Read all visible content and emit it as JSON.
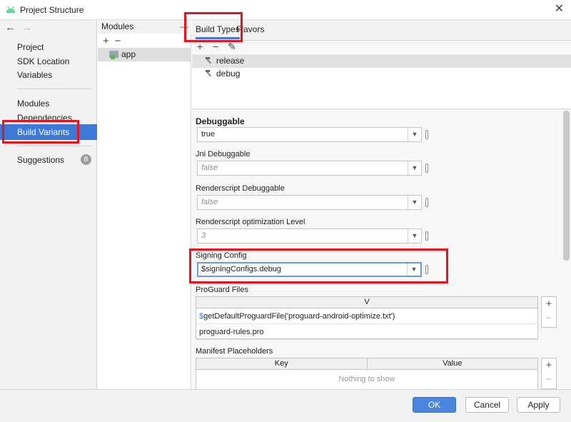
{
  "window": {
    "title": "Project Structure",
    "close_glyph": "✕"
  },
  "nav": {
    "back": "←",
    "forward": "→"
  },
  "sidebar": {
    "items": [
      {
        "label": "Project"
      },
      {
        "label": "SDK Location"
      },
      {
        "label": "Variables"
      },
      {
        "label": "Modules"
      },
      {
        "label": "Dependencies"
      },
      {
        "label": "Build Variants"
      },
      {
        "label": "Suggestions",
        "badge": "8"
      }
    ]
  },
  "modules": {
    "header": "Modules",
    "collapse_glyph": "—",
    "add": "+",
    "remove": "−",
    "items": [
      {
        "label": "app"
      }
    ]
  },
  "tabs": [
    {
      "label": "Build Types"
    },
    {
      "label": "Flavors"
    }
  ],
  "build_types": {
    "add": "+",
    "remove": "−",
    "edit": "✎",
    "items": [
      {
        "label": "release"
      },
      {
        "label": "debug"
      }
    ]
  },
  "form": {
    "debuggable": {
      "label": "Debuggable",
      "value": "true"
    },
    "jni_debuggable": {
      "label": "Jni Debuggable",
      "value": "false"
    },
    "renderscript_debuggable": {
      "label": "Renderscript Debuggable",
      "value": "false"
    },
    "renderscript_optimization": {
      "label": "Renderscript optimization Level",
      "value": "3"
    },
    "signing_config": {
      "label": "Signing Config",
      "value": "$signingConfigs.debug"
    },
    "proguard": {
      "label": "ProGuard Files",
      "column": "V",
      "rows": [
        {
          "prefix": "$",
          "text": "getDefaultProguardFile('proguard-android-optimize.txt')"
        },
        {
          "prefix": "",
          "text": "proguard-rules.pro"
        }
      ]
    },
    "manifest": {
      "label": "Manifest Placeholders",
      "columns": [
        "Key",
        "Value"
      ],
      "empty_text": "Nothing to show"
    },
    "side_add": "+",
    "side_remove": "−",
    "arrow": "▼"
  },
  "footer": {
    "ok": "OK",
    "cancel": "Cancel",
    "apply": "Apply"
  },
  "colors": {
    "accent": "#3d79d9",
    "highlight": "#e4161c",
    "android_green": "#3ddc84"
  }
}
